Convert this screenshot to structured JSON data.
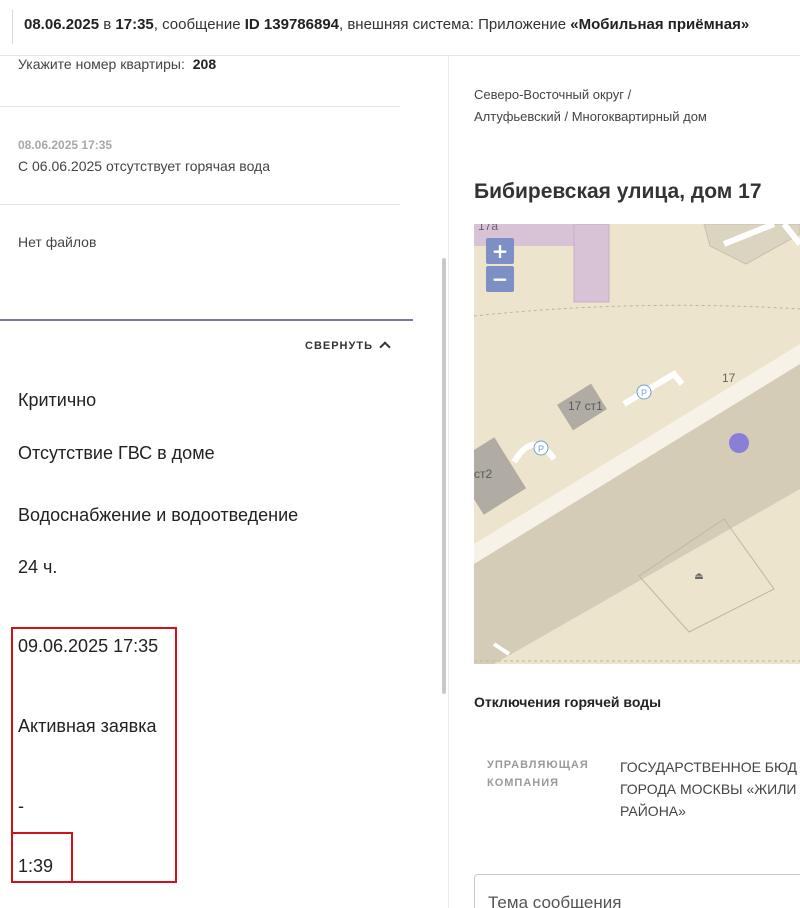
{
  "header": {
    "date": "08.06.2025",
    "in": "в",
    "time": "17:35",
    "message_prefix": ", сообщение",
    "id_label": "ID 139786894",
    "system_text": ", внешняя система: Приложение",
    "system_name": "«Мобильная приёмная»"
  },
  "left": {
    "apartment_label": "Укажите номер квартиры:",
    "apartment_value": "208",
    "comment_date": "08.06.2025 17:35",
    "comment_text": "С 06.06.2025 отсутствует горячая вода",
    "files_text": "Нет файлов",
    "collapse_label": "СВЕРНУТЬ",
    "values": {
      "priority": "Критично",
      "problem": "Отсутствие ГВС в доме",
      "category": "Водоснабжение и водоотведение",
      "sla": "24 ч.",
      "deadline": "09.06.2025 17:35",
      "status": "Активная заявка",
      "dash": "-",
      "timer": "1:39"
    }
  },
  "right": {
    "breadcrumb": "Северо-Восточный округ / Алтуфьевский / Многоквартирный дом",
    "street": "Бибиревская улица, дом 17",
    "map": {
      "zoom_in": "+",
      "zoom_out": "−",
      "labels": [
        "17а",
        "17",
        "17 ст1",
        "ст2",
        "P",
        "P"
      ],
      "marker_color": "#8a7fd6"
    },
    "hot_water_title": "Отключения горячей воды",
    "mc_label": "УПРАВЛЯЮЩАЯ КОМПАНИЯ",
    "mc_value_lines": [
      "ГОСУДАРСТВЕННОЕ БЮД",
      "ГОРОДА МОСКВЫ «ЖИЛИ",
      "РАЙОНА»"
    ],
    "topic_placeholder": "Тема сообщения"
  },
  "colors": {
    "accent": "#7b7a9c",
    "highlight": "#d0121b"
  }
}
